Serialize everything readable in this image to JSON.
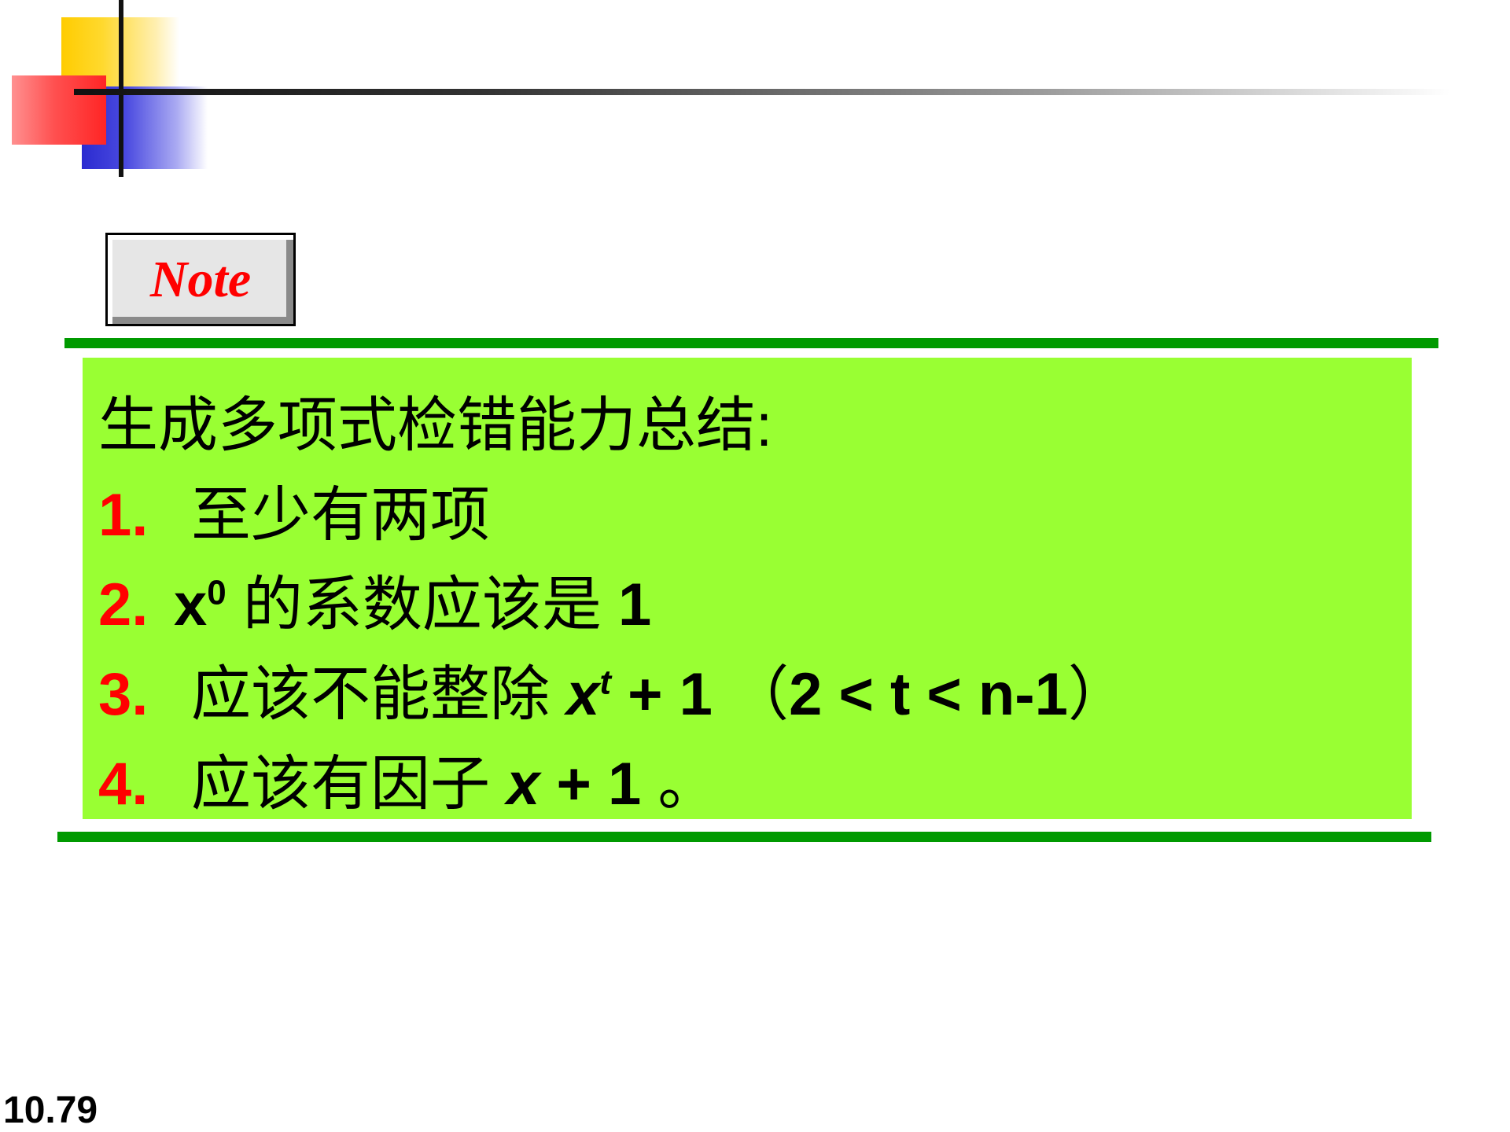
{
  "note_label": "Note",
  "heading": "生成多项式检错能力总结:",
  "items": [
    {
      "number": "1.",
      "parts": [
        "至少有两项"
      ]
    },
    {
      "number": "2.",
      "parts": [
        "x",
        "0",
        " 的系数应该是 ",
        "1"
      ]
    },
    {
      "number": "3.",
      "parts": [
        "应该不能整除 ",
        "x",
        "t",
        " + 1",
        " （",
        "2 < t < n-1",
        "）"
      ]
    },
    {
      "number": "4.",
      "parts": [
        "应该有因子 ",
        "x",
        " + 1",
        " 。"
      ]
    }
  ],
  "page_number": "10.79",
  "colors": {
    "accent_red": "#ff0000",
    "box_green": "#99ff33",
    "rule_green": "#009a00"
  },
  "icons": [
    "decorative-logo"
  ]
}
